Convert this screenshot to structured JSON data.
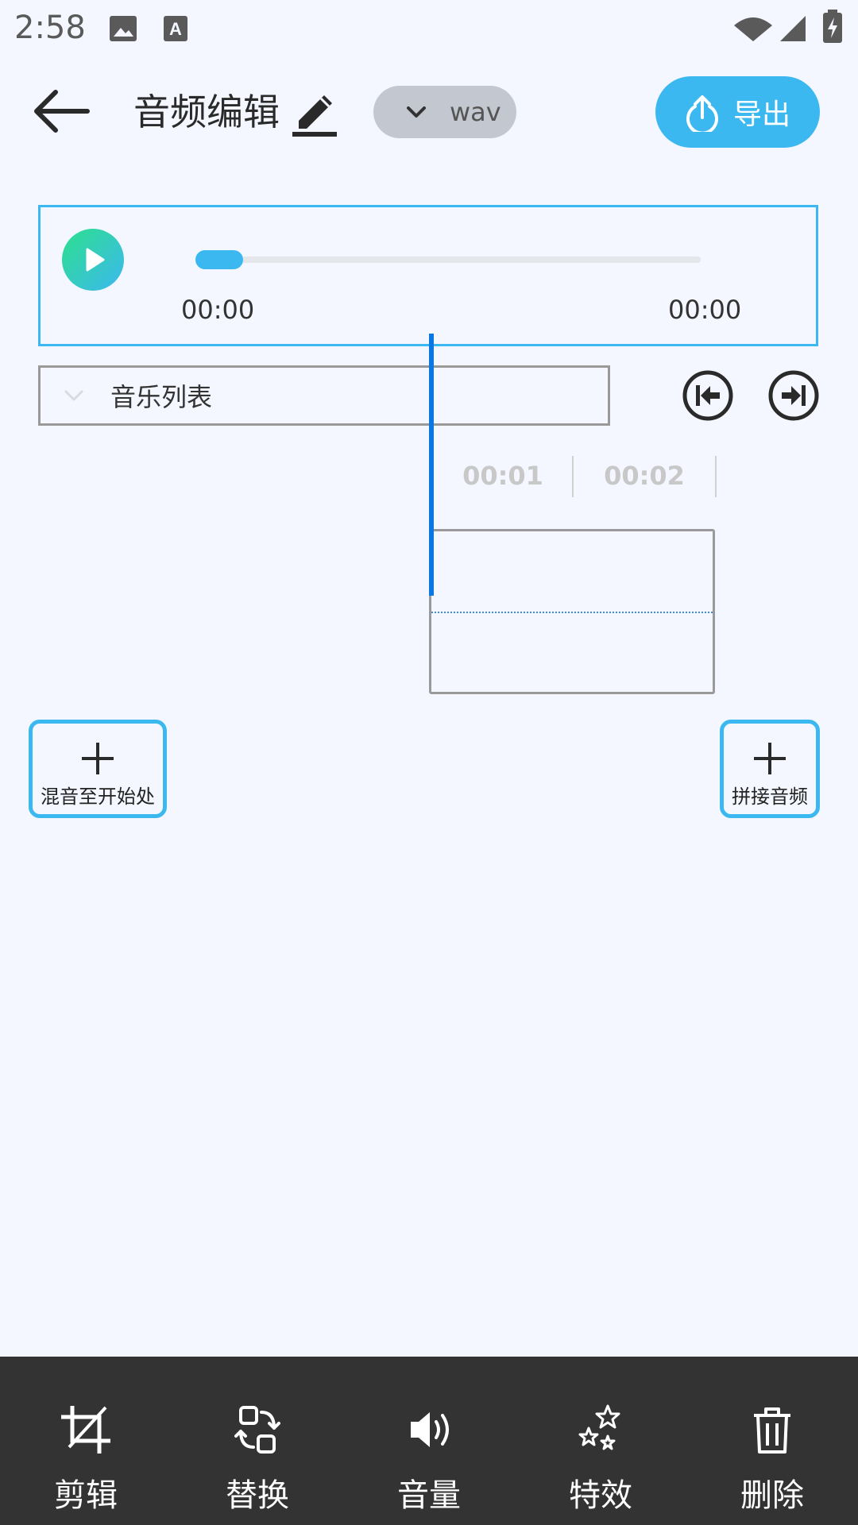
{
  "status_bar": {
    "time": "2:58",
    "icons": [
      "image-icon",
      "keyboard-a-icon",
      "wifi-icon",
      "signal-icon",
      "battery-charging-icon"
    ]
  },
  "header": {
    "back_icon": "arrow-left-icon",
    "title": "音频编辑",
    "edit_icon": "pencil-icon",
    "format": "wav",
    "export_label": "导出",
    "export_icon": "upload-icon"
  },
  "player": {
    "current_time": "00:00",
    "total_time": "00:00",
    "progress": 0
  },
  "music_list": {
    "label": "音乐列表"
  },
  "timeline": {
    "ticks": [
      "00:01",
      "00:02"
    ]
  },
  "actions": {
    "mix_start_label": "混音至开始处",
    "append_label": "拼接音频"
  },
  "toolbar": {
    "items": [
      {
        "label": "剪辑",
        "icon": "crop-icon"
      },
      {
        "label": "替换",
        "icon": "swap-icon"
      },
      {
        "label": "音量",
        "icon": "volume-icon"
      },
      {
        "label": "特效",
        "icon": "stars-icon"
      },
      {
        "label": "删除",
        "icon": "trash-icon"
      }
    ]
  },
  "colors": {
    "accent": "#3cb8f0",
    "background": "#f4f7ff",
    "toolbar_bg": "#333333",
    "playhead": "#0a78e0"
  }
}
